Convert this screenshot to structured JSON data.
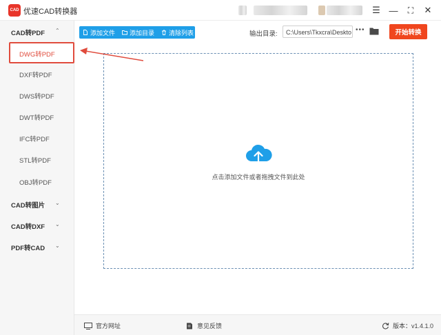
{
  "window": {
    "title": "优速CAD转换器",
    "logo_text": "CAD",
    "controls": {
      "menu": "☰",
      "minimize": "—",
      "maximize": "⛶",
      "close": "✕"
    }
  },
  "sidebar": {
    "groups": [
      {
        "label": "CAD转PDF",
        "chevron": "⌃",
        "expanded": true,
        "items": [
          {
            "label": "DWG转PDF",
            "active": true
          },
          {
            "label": "DXF转PDF"
          },
          {
            "label": "DWS转PDF"
          },
          {
            "label": "DWT转PDF"
          },
          {
            "label": "IFC转PDF"
          },
          {
            "label": "STL转PDF"
          },
          {
            "label": "OBJ转PDF"
          }
        ]
      },
      {
        "label": "CAD转图片",
        "chevron": "⌄"
      },
      {
        "label": "CAD转DXF",
        "chevron": "⌄"
      },
      {
        "label": "PDF转CAD",
        "chevron": "⌄"
      }
    ]
  },
  "toolbar": {
    "add_file": "添加文件",
    "add_folder": "添加目录",
    "clear_list": "清除列表",
    "output_label": "输出目录:",
    "output_path": "C:\\Users\\Tkxcra\\Deskto",
    "more": "•••",
    "start": "开始转换"
  },
  "dropzone": {
    "hint": "点击添加文件或者拖拽文件到此处"
  },
  "footer": {
    "website": "官方网址",
    "feedback": "意见反馈",
    "version": "版本：v1.4.1.0"
  },
  "colors": {
    "accent_blue": "#1f9fe8",
    "start_orange": "#f0461e",
    "active_red": "#e04b3c"
  }
}
